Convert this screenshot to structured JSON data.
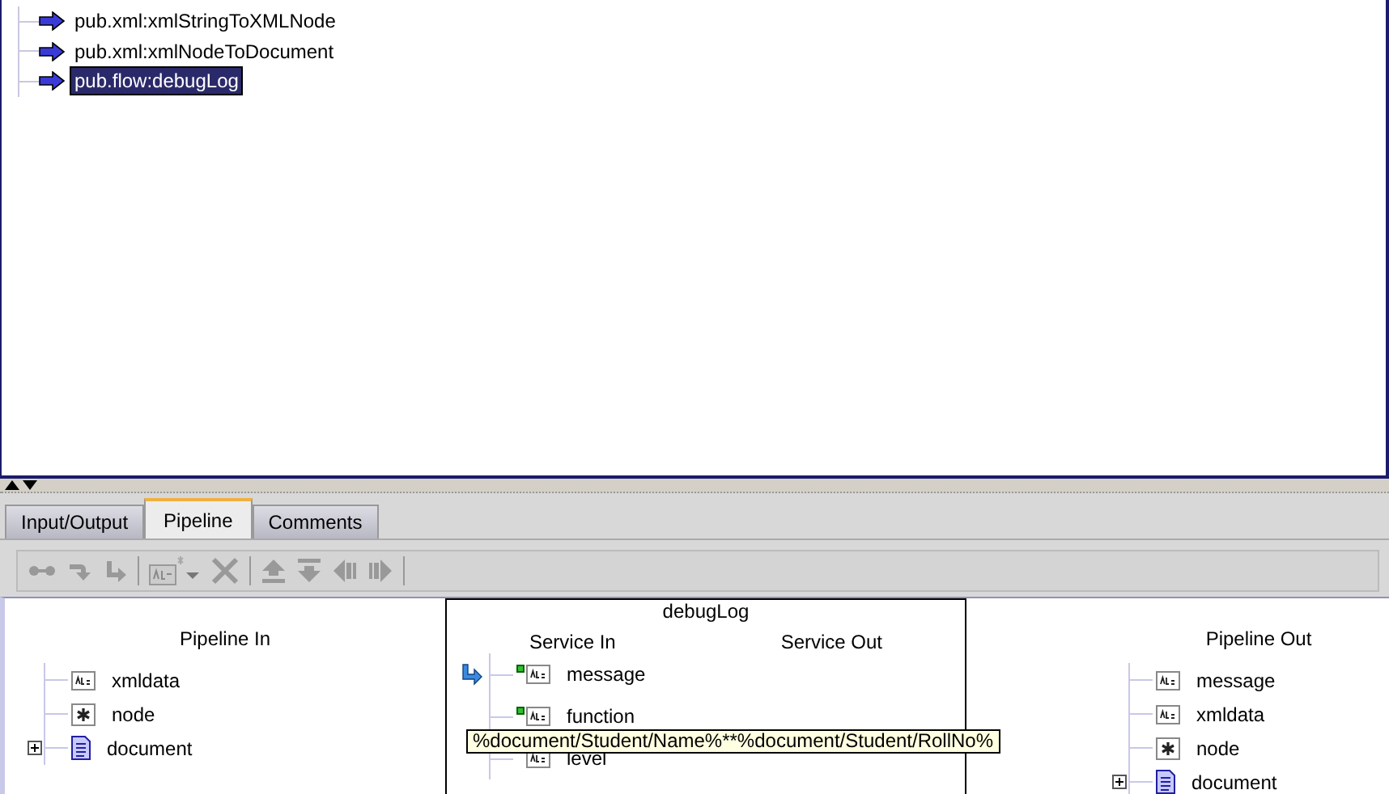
{
  "flow_steps": [
    {
      "label": "pub.xml:xmlStringToXMLNode",
      "selected": false
    },
    {
      "label": "pub.xml:xmlNodeToDocument",
      "selected": false
    },
    {
      "label": "pub.flow:debugLog",
      "selected": true
    }
  ],
  "tabs": [
    {
      "label": "Input/Output",
      "selected": false
    },
    {
      "label": "Pipeline",
      "selected": true
    },
    {
      "label": "Comments",
      "selected": false
    }
  ],
  "pipeline_in": {
    "title": "Pipeline In",
    "items": [
      {
        "name": "xmldata",
        "kind": "string",
        "expandable": false
      },
      {
        "name": "node",
        "kind": "object",
        "expandable": false
      },
      {
        "name": "document",
        "kind": "document",
        "expandable": true
      }
    ]
  },
  "service": {
    "title": "debugLog",
    "in_title": "Service In",
    "out_title": "Service Out",
    "items": [
      {
        "name": "message",
        "kind": "string",
        "mapped": true,
        "value_set": true
      },
      {
        "name": "function",
        "kind": "string",
        "mapped": true,
        "value_set": false
      },
      {
        "name": "level",
        "kind": "string",
        "mapped": false,
        "value_set": false
      }
    ]
  },
  "pipeline_out": {
    "title": "Pipeline Out",
    "items": [
      {
        "name": "message",
        "kind": "string",
        "expandable": false
      },
      {
        "name": "xmldata",
        "kind": "string",
        "expandable": false
      },
      {
        "name": "node",
        "kind": "object",
        "expandable": false
      },
      {
        "name": "document",
        "kind": "document",
        "expandable": true
      }
    ]
  },
  "tooltip": "%document/Student/Name%**%document/Student/RollNo%"
}
